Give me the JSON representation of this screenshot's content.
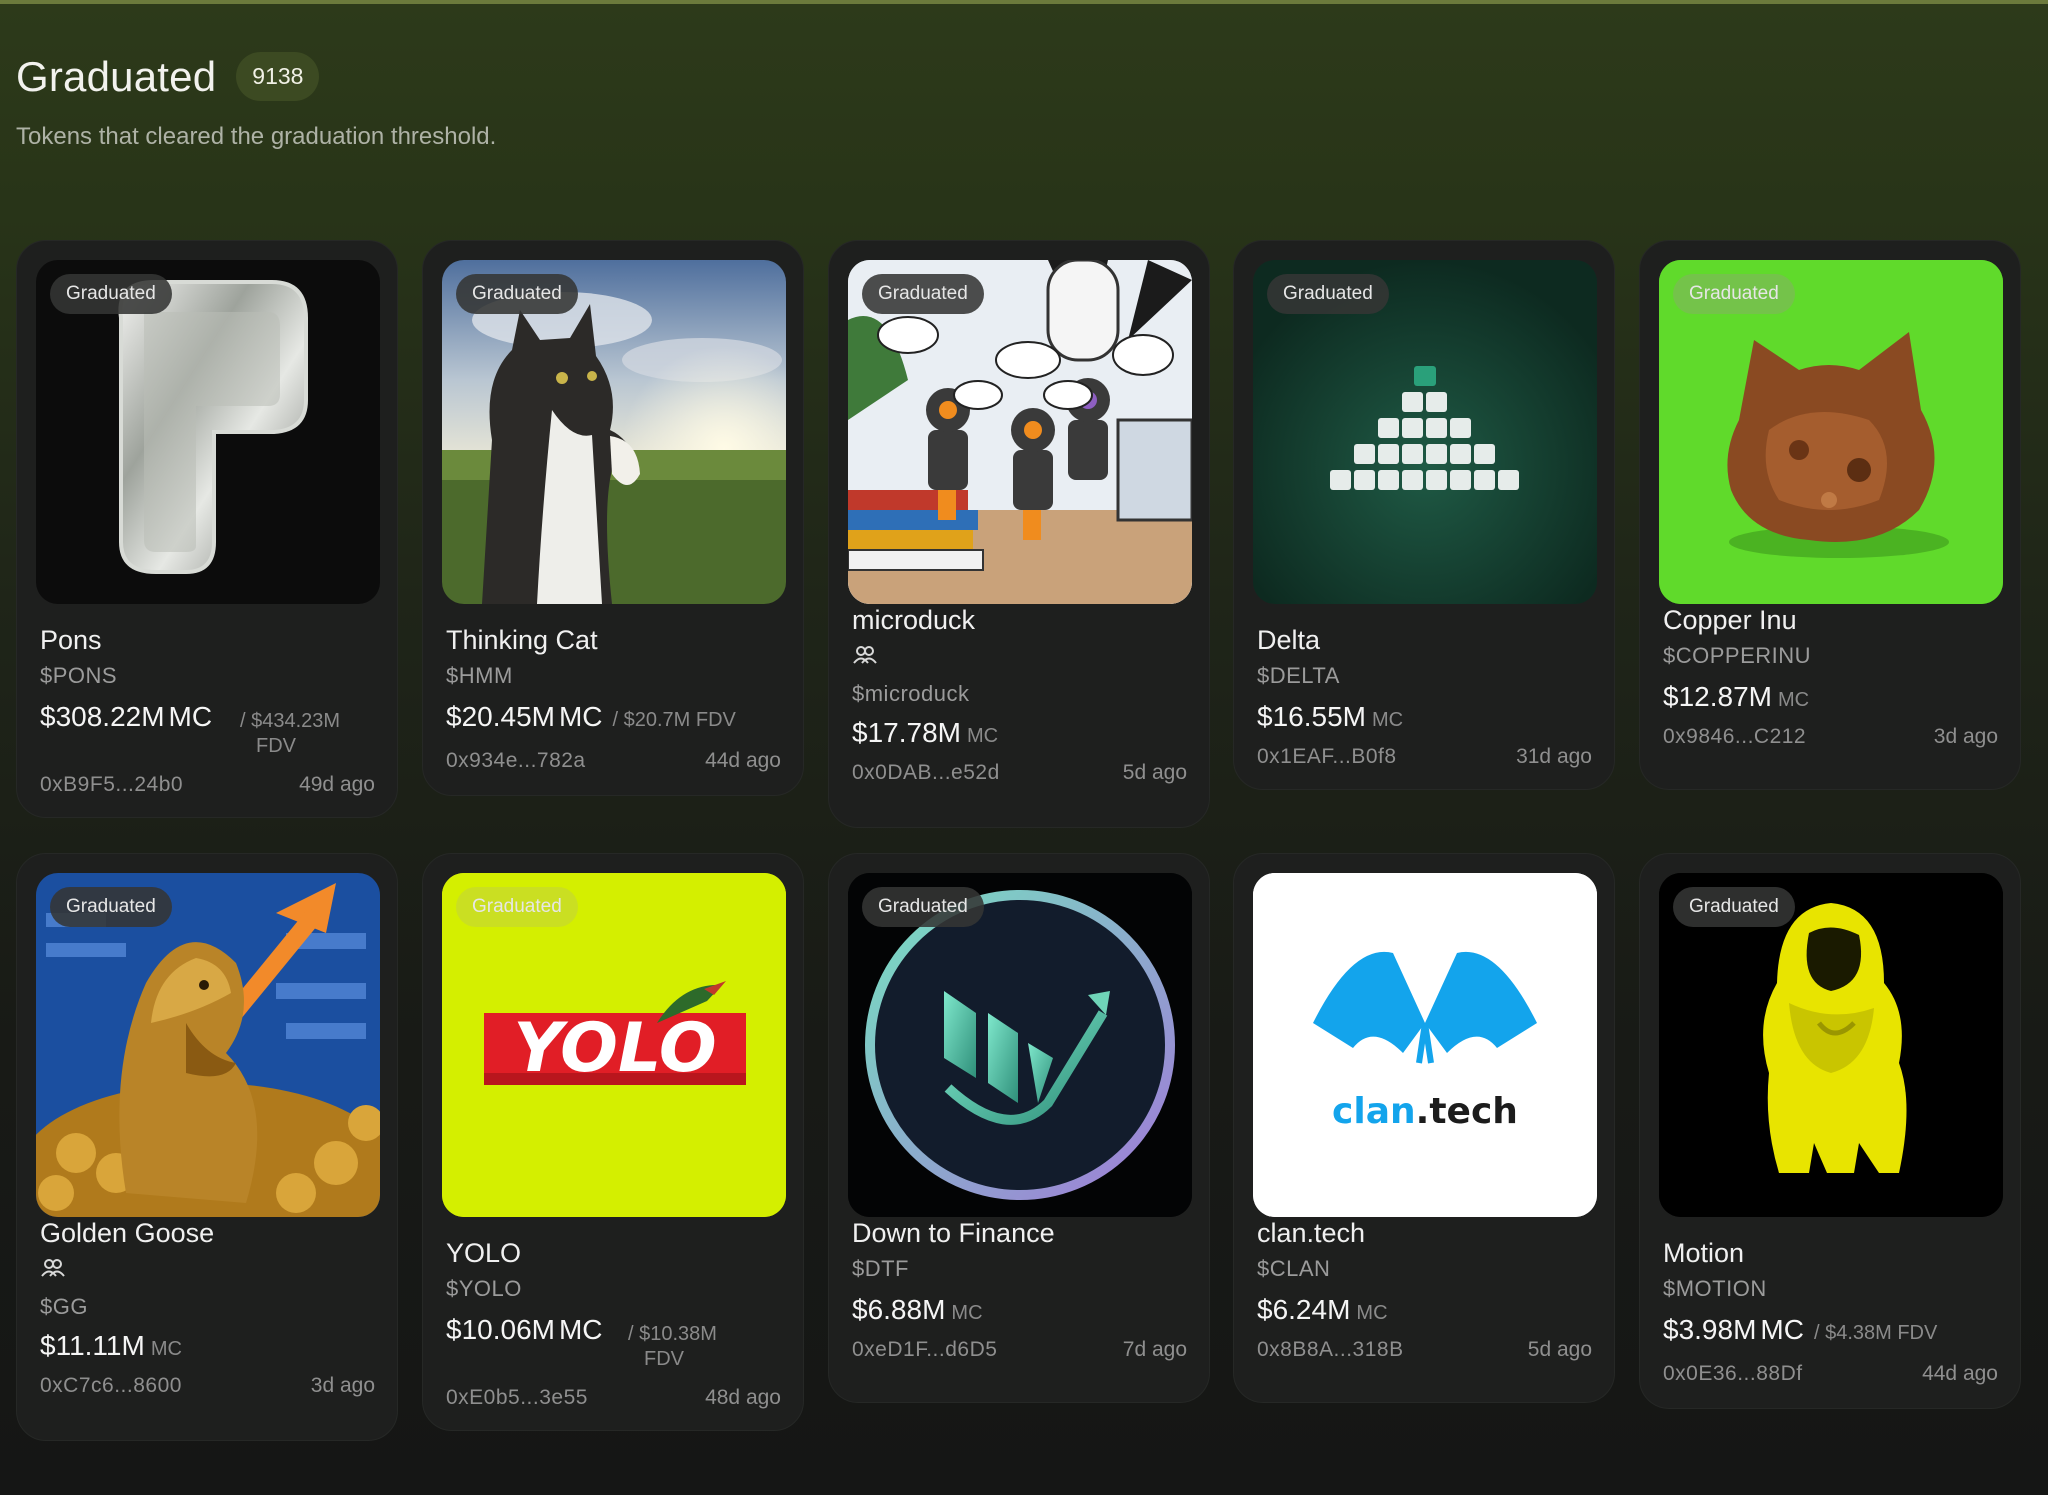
{
  "header": {
    "title": "Graduated",
    "count": "9138",
    "subtitle": "Tokens that cleared the graduation threshold."
  },
  "badge_label": "Graduated",
  "tokens": [
    {
      "name": "Pons",
      "ticker": "$PONS",
      "mc": "$308.22M",
      "mc_unit": "MC",
      "fdv_prefix": "/",
      "fdv": "$434.23M",
      "fdv_unit": "FDV",
      "address": "0xB9F5...24b0",
      "age": "49d ago"
    },
    {
      "name": "Thinking Cat",
      "ticker": "$HMM",
      "mc": "$20.45M",
      "mc_unit": "MC",
      "fdv_text": "/ $20.7M FDV",
      "address": "0x934e...782a",
      "age": "44d ago"
    },
    {
      "name": "microduck",
      "ticker": "$microduck",
      "mc": "$17.78M",
      "mc_unit": "MC",
      "address": "0x0DAB...e52d",
      "age": "5d ago"
    },
    {
      "name": "Delta",
      "ticker": "$DELTA",
      "mc": "$16.55M",
      "mc_unit": "MC",
      "address": "0x1EAF...B0f8",
      "age": "31d ago"
    },
    {
      "name": "Copper Inu",
      "ticker": "$COPPERINU",
      "mc": "$12.87M",
      "mc_unit": "MC",
      "address": "0x9846...C212",
      "age": "3d ago"
    },
    {
      "name": "Golden Goose",
      "ticker": "$GG",
      "mc": "$11.11M",
      "mc_unit": "MC",
      "address": "0xC7c6...8600",
      "age": "3d ago"
    },
    {
      "name": "YOLO",
      "ticker": "$YOLO",
      "mc": "$10.06M",
      "mc_unit": "MC",
      "fdv_prefix": "/",
      "fdv": "$10.38M",
      "fdv_unit": "FDV",
      "address": "0xE0b5...3e55",
      "age": "48d ago",
      "logo_text": "YOLO"
    },
    {
      "name": "Down to Finance",
      "ticker": "$DTF",
      "mc": "$6.88M",
      "mc_unit": "MC",
      "address": "0xeD1F...d6D5",
      "age": "7d ago"
    },
    {
      "name": "clan.tech",
      "ticker": "$CLAN",
      "mc": "$6.24M",
      "mc_unit": "MC",
      "address": "0x8B8A...318B",
      "age": "5d ago",
      "logo_text_a": "clan",
      "logo_text_b": ".tech"
    },
    {
      "name": "Motion",
      "ticker": "$MOTION",
      "mc": "$3.98M",
      "mc_unit": "MC",
      "fdv_text": "/ $4.38M FDV",
      "address": "0x0E36...88Df",
      "age": "44d ago"
    }
  ],
  "icons": {
    "holders": "people-icon"
  }
}
